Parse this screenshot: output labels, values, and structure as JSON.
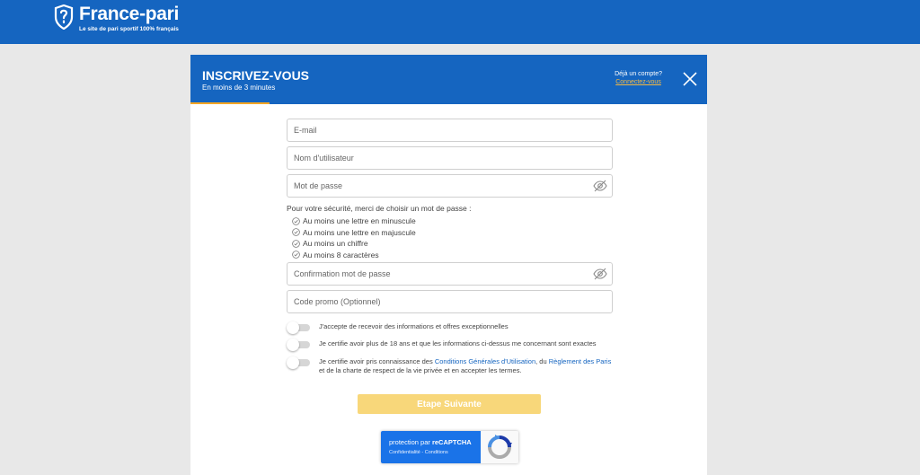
{
  "brand": {
    "name": "France-pari",
    "tagline": "Le site de pari sportif 100% français"
  },
  "modal": {
    "title": "INSCRIVEZ-VOUS",
    "subtitle": "En moins de 3 minutes",
    "already_account": "Déjà un compte?",
    "login_link": "Connectez-vous"
  },
  "form": {
    "email_placeholder": "E-mail",
    "username_placeholder": "Nom d'utilisateur",
    "password_placeholder": "Mot de passe",
    "password_rules_intro": "Pour votre sécurité, merci de choisir un mot de passe :",
    "password_rules": [
      "Au moins une lettre en minuscule",
      "Au moins une lettre en majuscule",
      "Au moins un chiffre",
      "Au moins 8 caractères"
    ],
    "confirm_placeholder": "Confirmation mot de passe",
    "promo_placeholder": "Code promo (Optionnel)"
  },
  "consents": {
    "offers": "J'accepte de recevoir des informations et offres exceptionnelles",
    "age": "Je certifie avoir plus de 18 ans et que les informations ci-dessus me concernant sont exactes",
    "terms_part1": "Je certifie avoir pris connaissance des ",
    "terms_link1": "Conditions Générales d'Utilisation",
    "terms_part2": ", du ",
    "terms_link2": "Règlement des Paris",
    "terms_part3": " et de la charte de respect de la vie privée et en accepter les termes."
  },
  "next_button": "Etape Suivante",
  "recaptcha": {
    "title_prefix": "protection par ",
    "title_brand": "reCAPTCHA",
    "links": "Confidentialité - Conditions"
  },
  "colors": {
    "brand_blue": "#1565c0",
    "accent_orange": "#f5a623",
    "button_yellow": "#f8d77a"
  }
}
